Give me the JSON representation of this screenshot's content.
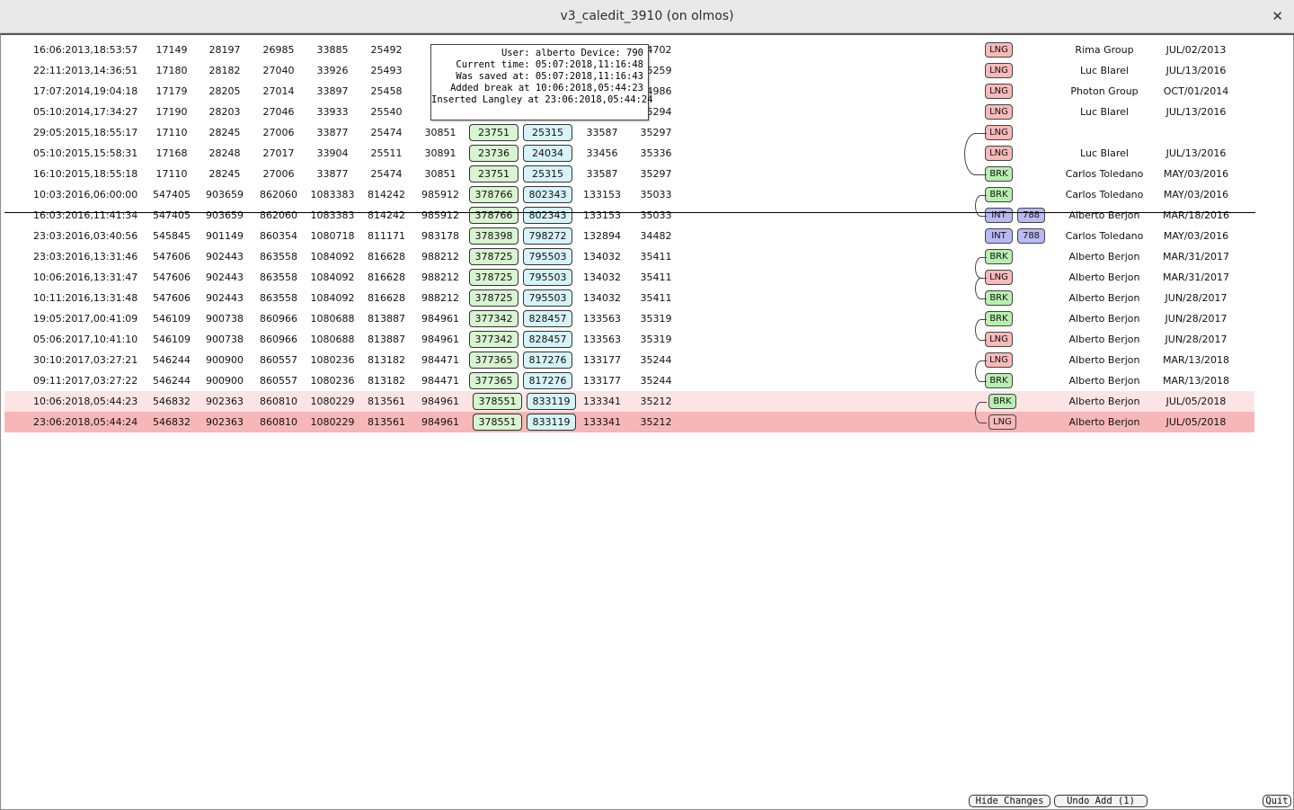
{
  "window": {
    "title": "v3_caledit_3910 (on olmos)",
    "close_glyph": "✕"
  },
  "tooltip": {
    "lines": [
      "User: alberto Device: 790",
      "Current time: 05:07:2018,11:16:48",
      "Was saved at: 05:07:2018,11:16:43",
      "Added break at 10:06:2018,05:44:23",
      "Inserted Langley at 23:06:2018,05:44:24"
    ]
  },
  "rows": [
    {
      "timestamp": "16:06:2013,18:53:57",
      "v1": "17149",
      "v2": "28197",
      "v3": "26985",
      "v4": "33885",
      "v5": "25492",
      "v6": "",
      "g": "",
      "b": "",
      "v9": "",
      "v10": "34702",
      "tag": "LNG",
      "tag2": "",
      "name": "Rima Group",
      "date": "JUL/02/2013"
    },
    {
      "timestamp": "22:11:2013,14:36:51",
      "v1": "17180",
      "v2": "28182",
      "v3": "27040",
      "v4": "33926",
      "v5": "25493",
      "v6": "",
      "g": "",
      "b": "",
      "v9": "",
      "v10": "35259",
      "tag": "LNG",
      "tag2": "",
      "name": "Luc Blarel",
      "date": "JUL/13/2016"
    },
    {
      "timestamp": "17:07:2014,19:04:18",
      "v1": "17179",
      "v2": "28205",
      "v3": "27014",
      "v4": "33897",
      "v5": "25458",
      "v6": "",
      "g": "",
      "b": "",
      "v9": "",
      "v10": "34986",
      "tag": "LNG",
      "tag2": "",
      "name": "Photon Group",
      "date": "OCT/01/2014"
    },
    {
      "timestamp": "05:10:2014,17:34:27",
      "v1": "17190",
      "v2": "28203",
      "v3": "27046",
      "v4": "33933",
      "v5": "25540",
      "v6": "",
      "g": "",
      "b": "",
      "v9": "",
      "v10": "35294",
      "tag": "LNG",
      "tag2": "",
      "name": "Luc Blarel",
      "date": "JUL/13/2016"
    },
    {
      "timestamp": "29:05:2015,18:55:17",
      "v1": "17110",
      "v2": "28245",
      "v3": "27006",
      "v4": "33877",
      "v5": "25474",
      "v6": "30851",
      "g": "23751",
      "b": "25315",
      "v9": "33587",
      "v10": "35297",
      "tag": "LNG",
      "tag2": "",
      "name": "",
      "date": ""
    },
    {
      "timestamp": "05:10:2015,15:58:31",
      "v1": "17168",
      "v2": "28248",
      "v3": "27017",
      "v4": "33904",
      "v5": "25511",
      "v6": "30891",
      "g": "23736",
      "b": "24034",
      "v9": "33456",
      "v10": "35336",
      "tag": "LNG",
      "tag2": "",
      "name": "Luc Blarel",
      "date": "JUL/13/2016"
    },
    {
      "timestamp": "16:10:2015,18:55:18",
      "v1": "17110",
      "v2": "28245",
      "v3": "27006",
      "v4": "33877",
      "v5": "25474",
      "v6": "30851",
      "g": "23751",
      "b": "25315",
      "v9": "33587",
      "v10": "35297",
      "tag": "BRK",
      "tag2": "",
      "name": "Carlos Toledano",
      "date": "MAY/03/2016"
    },
    {
      "timestamp": "10:03:2016,06:00:00",
      "v1": "547405",
      "v2": "903659",
      "v3": "862060",
      "v4": "1083383",
      "v5": "814242",
      "v6": "985912",
      "g": "378766",
      "b": "802343",
      "v9": "133153",
      "v10": "35033",
      "tag": "BRK",
      "tag2": "",
      "name": "Carlos Toledano",
      "date": "MAY/03/2016"
    },
    {
      "timestamp": "16:03:2016,11:41:34",
      "v1": "547405",
      "v2": "903659",
      "v3": "862060",
      "v4": "1083383",
      "v5": "814242",
      "v6": "985912",
      "g": "378766",
      "b": "802343",
      "v9": "133153",
      "v10": "35033",
      "tag": "INT",
      "tag2": "788",
      "name": "Alberto Berjon",
      "date": "MAR/18/2016"
    },
    {
      "timestamp": "23:03:2016,03:40:56",
      "v1": "545845",
      "v2": "901149",
      "v3": "860354",
      "v4": "1080718",
      "v5": "811171",
      "v6": "983178",
      "g": "378398",
      "b": "798272",
      "v9": "132894",
      "v10": "34482",
      "tag": "INT",
      "tag2": "788",
      "name": "Carlos Toledano",
      "date": "MAY/03/2016"
    },
    {
      "timestamp": "23:03:2016,13:31:46",
      "v1": "547606",
      "v2": "902443",
      "v3": "863558",
      "v4": "1084092",
      "v5": "816628",
      "v6": "988212",
      "g": "378725",
      "b": "795503",
      "v9": "134032",
      "v10": "35411",
      "tag": "BRK",
      "tag2": "",
      "name": "Alberto Berjon",
      "date": "MAR/31/2017"
    },
    {
      "timestamp": "10:06:2016,13:31:47",
      "v1": "547606",
      "v2": "902443",
      "v3": "863558",
      "v4": "1084092",
      "v5": "816628",
      "v6": "988212",
      "g": "378725",
      "b": "795503",
      "v9": "134032",
      "v10": "35411",
      "tag": "LNG",
      "tag2": "",
      "name": "Alberto Berjon",
      "date": "MAR/31/2017"
    },
    {
      "timestamp": "10:11:2016,13:31:48",
      "v1": "547606",
      "v2": "902443",
      "v3": "863558",
      "v4": "1084092",
      "v5": "816628",
      "v6": "988212",
      "g": "378725",
      "b": "795503",
      "v9": "134032",
      "v10": "35411",
      "tag": "BRK",
      "tag2": "",
      "name": "Alberto Berjon",
      "date": "JUN/28/2017"
    },
    {
      "timestamp": "19:05:2017,00:41:09",
      "v1": "546109",
      "v2": "900738",
      "v3": "860966",
      "v4": "1080688",
      "v5": "813887",
      "v6": "984961",
      "g": "377342",
      "b": "828457",
      "v9": "133563",
      "v10": "35319",
      "tag": "BRK",
      "tag2": "",
      "name": "Alberto Berjon",
      "date": "JUN/28/2017"
    },
    {
      "timestamp": "05:06:2017,10:41:10",
      "v1": "546109",
      "v2": "900738",
      "v3": "860966",
      "v4": "1080688",
      "v5": "813887",
      "v6": "984961",
      "g": "377342",
      "b": "828457",
      "v9": "133563",
      "v10": "35319",
      "tag": "LNG",
      "tag2": "",
      "name": "Alberto Berjon",
      "date": "JUN/28/2017"
    },
    {
      "timestamp": "30:10:2017,03:27:21",
      "v1": "546244",
      "v2": "900900",
      "v3": "860557",
      "v4": "1080236",
      "v5": "813182",
      "v6": "984471",
      "g": "377365",
      "b": "817276",
      "v9": "133177",
      "v10": "35244",
      "tag": "LNG",
      "tag2": "",
      "name": "Alberto Berjon",
      "date": "MAR/13/2018"
    },
    {
      "timestamp": "09:11:2017,03:27:22",
      "v1": "546244",
      "v2": "900900",
      "v3": "860557",
      "v4": "1080236",
      "v5": "813182",
      "v6": "984471",
      "g": "377365",
      "b": "817276",
      "v9": "133177",
      "v10": "35244",
      "tag": "BRK",
      "tag2": "",
      "name": "Alberto Berjon",
      "date": "MAR/13/2018"
    },
    {
      "timestamp": "10:06:2018,05:44:23",
      "v1": "546832",
      "v2": "902363",
      "v3": "860810",
      "v4": "1080229",
      "v5": "813561",
      "v6": "984961",
      "g": "378551",
      "b": "833119",
      "v9": "133341",
      "v10": "35212",
      "tag": "BRK",
      "tag2": "",
      "name": "Alberto Berjon",
      "date": "JUL/05/2018"
    },
    {
      "timestamp": "23:06:2018,05:44:24",
      "v1": "546832",
      "v2": "902363",
      "v3": "860810",
      "v4": "1080229",
      "v5": "813561",
      "v6": "984961",
      "g": "378551",
      "b": "833119",
      "v9": "133341",
      "v10": "35212",
      "tag": "LNG",
      "tag2": "",
      "name": "Alberto Berjon",
      "date": "JUL/05/2018"
    }
  ],
  "buttons": {
    "hide_changes": "Hide Changes",
    "undo_add": "Undo Add (1)",
    "quit": "Quit"
  },
  "colors": {
    "lng_tag": "#f7b9b9",
    "brk_tag": "#b9efb0",
    "int_tag": "#b9b9f5",
    "green_cell": "#d8f4d0",
    "blue_cell": "#d6f4f7",
    "highlight_light": "#fde4e4",
    "highlight_strong": "#f7b7b8"
  }
}
